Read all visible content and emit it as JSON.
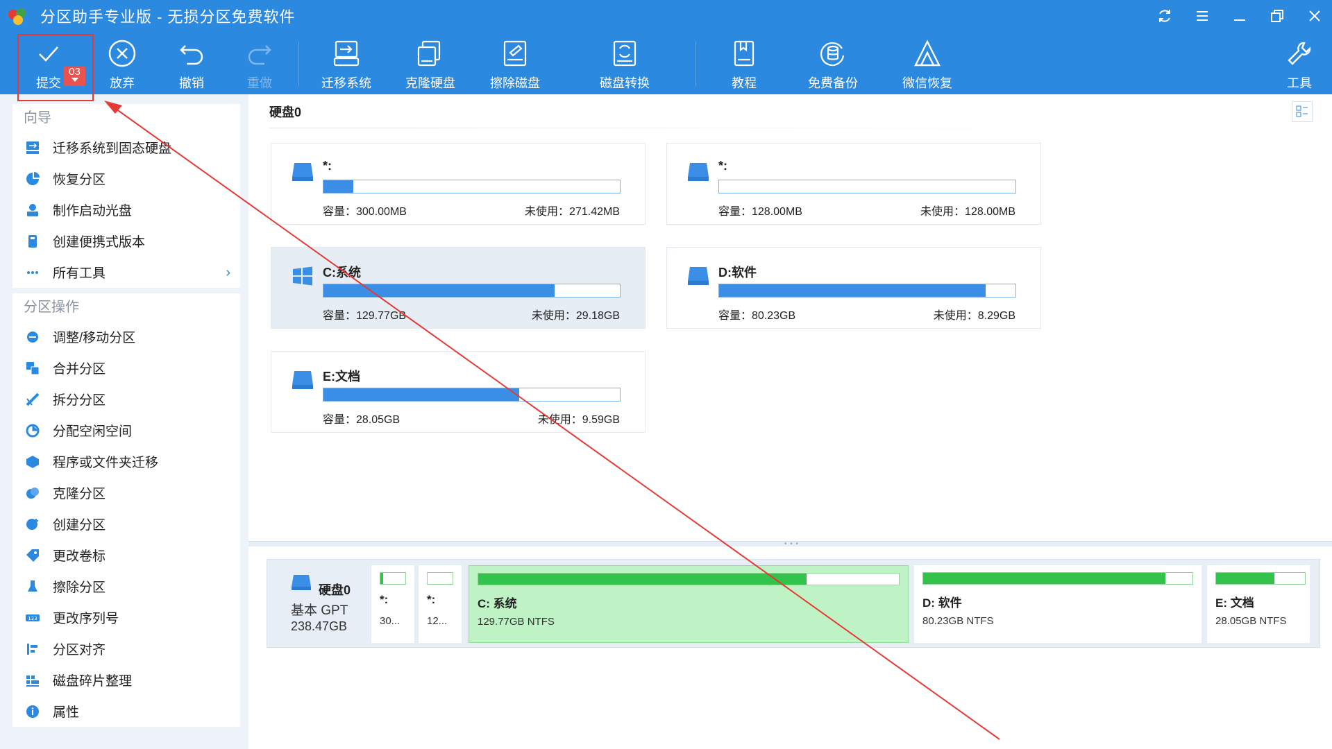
{
  "window": {
    "title": "分区助手专业版 - 无损分区免费软件",
    "controls": [
      "refresh-icon",
      "menu-icon",
      "minimize-icon",
      "restore-icon",
      "close-icon"
    ]
  },
  "toolbar": {
    "commit": {
      "label": "提交",
      "badge": "03"
    },
    "discard": {
      "label": "放弃"
    },
    "undo": {
      "label": "撤销"
    },
    "redo": {
      "label": "重做"
    },
    "migrate": {
      "label": "迁移系统"
    },
    "clone": {
      "label": "克隆硬盘"
    },
    "wipe": {
      "label": "擦除磁盘"
    },
    "convert": {
      "label": "磁盘转换"
    },
    "tutorial": {
      "label": "教程"
    },
    "backup": {
      "label": "免费备份"
    },
    "wechat": {
      "label": "微信恢复"
    },
    "tools": {
      "label": "工具"
    }
  },
  "sidebar": {
    "wizard": {
      "header": "向导",
      "items": [
        {
          "label": "迁移系统到固态硬盘",
          "icon": "migrate-icon"
        },
        {
          "label": "恢复分区",
          "icon": "recover-icon"
        },
        {
          "label": "制作启动光盘",
          "icon": "boot-disc-icon"
        },
        {
          "label": "创建便携式版本",
          "icon": "portable-icon"
        },
        {
          "label": "所有工具",
          "icon": "more-icon"
        }
      ]
    },
    "operations": {
      "header": "分区操作",
      "items": [
        {
          "label": "调整/移动分区",
          "icon": "resize-icon"
        },
        {
          "label": "合并分区",
          "icon": "merge-icon"
        },
        {
          "label": "拆分分区",
          "icon": "split-icon"
        },
        {
          "label": "分配空闲空间",
          "icon": "allocate-icon"
        },
        {
          "label": "程序或文件夹迁移",
          "icon": "app-move-icon"
        },
        {
          "label": "克隆分区",
          "icon": "clone-partition-icon"
        },
        {
          "label": "创建分区",
          "icon": "create-partition-icon"
        },
        {
          "label": "更改卷标",
          "icon": "label-icon"
        },
        {
          "label": "擦除分区",
          "icon": "wipe-partition-icon"
        },
        {
          "label": "更改序列号",
          "icon": "serial-icon"
        },
        {
          "label": "分区对齐",
          "icon": "align-icon"
        },
        {
          "label": "磁盘碎片整理",
          "icon": "defrag-icon"
        },
        {
          "label": "属性",
          "icon": "info-icon"
        }
      ]
    }
  },
  "main": {
    "disk_title": "硬盘0",
    "partitions": [
      {
        "name": "*:",
        "capacity": "容量：300.00MB",
        "free": "未使用：271.42MB",
        "used_fraction": 0.1,
        "icon": "drive-icon"
      },
      {
        "name": "*:",
        "capacity": "容量：128.00MB",
        "free": "未使用：128.00MB",
        "used_fraction": 0.0,
        "icon": "drive-icon"
      },
      {
        "name": "C:系统",
        "capacity": "容量：129.77GB",
        "free": "未使用：29.18GB",
        "used_fraction": 0.78,
        "icon": "windows-icon"
      },
      {
        "name": "D:软件",
        "capacity": "容量：80.23GB",
        "free": "未使用：8.29GB",
        "used_fraction": 0.9,
        "icon": "drive-icon"
      },
      {
        "name": "E:文档",
        "capacity": "容量：28.05GB",
        "free": "未使用：9.59GB",
        "used_fraction": 0.66,
        "icon": "drive-icon"
      }
    ]
  },
  "diskmap": {
    "name": "硬盘0",
    "type": "基本 GPT",
    "size": "238.47GB",
    "parts": [
      {
        "name": "*:",
        "detail": "30...",
        "used_fraction": 0.12
      },
      {
        "name": "*:",
        "detail": "12...",
        "used_fraction": 0.0
      },
      {
        "name": "C: 系统",
        "detail": "129.77GB NTFS",
        "used_fraction": 0.78
      },
      {
        "name": "D: 软件",
        "detail": "80.23GB NTFS",
        "used_fraction": 0.9
      },
      {
        "name": "E: 文档",
        "detail": "28.05GB NTFS",
        "used_fraction": 0.66
      }
    ]
  },
  "colors": {
    "accent": "#2b89e0",
    "bar": "#3a8ee6",
    "map_bar": "#33c24c",
    "annotation": "#e53935"
  }
}
